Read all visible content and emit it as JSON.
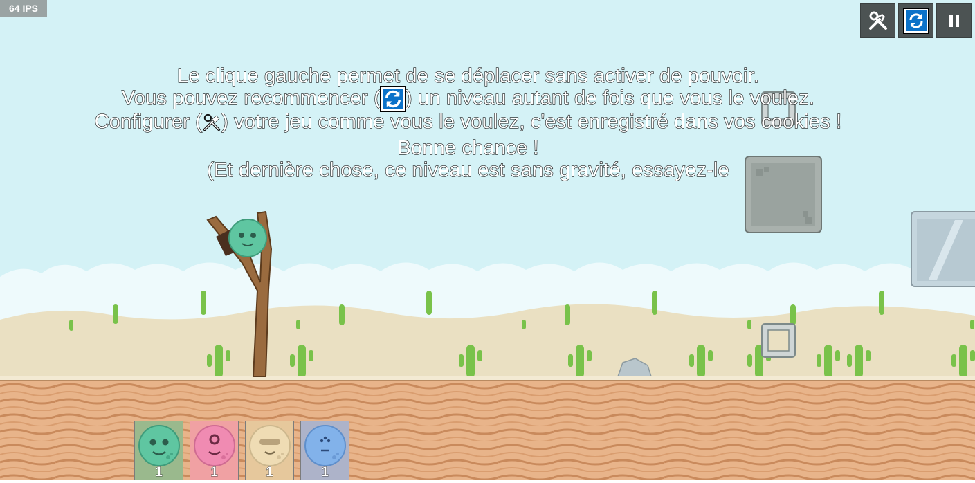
{
  "hud": {
    "fps_label": "64 IPS",
    "buttons": [
      {
        "name": "settings",
        "icon": "tools-icon"
      },
      {
        "name": "restart",
        "icon": "refresh-icon"
      },
      {
        "name": "pause",
        "icon": "pause-icon"
      }
    ]
  },
  "instructions": {
    "line1": "Le clique gauche permet de se déplacer sans activer de pouvoir.",
    "line2_before": "Vous pouvez recommencer (",
    "line2_after": ") un niveau autant de fois que vous le voulez.",
    "line3_before": "Configurer (",
    "line3_after": ") votre jeu comme vous le voulez, c'est enregistré dans vos cookies !",
    "line4": "Bonne chance !",
    "line5": "(Et dernière chose, ce niveau est sans gravité, essayez-le"
  },
  "birds": [
    {
      "kind": "green",
      "count": "1",
      "color": "#5fc6a1",
      "slot_bg": "#9ab98d"
    },
    {
      "kind": "pink",
      "count": "1",
      "color": "#f08bb2",
      "slot_bg": "#f0a1a3"
    },
    {
      "kind": "beige",
      "count": "1",
      "color": "#efdcb4",
      "slot_bg": "#e6c89c"
    },
    {
      "kind": "blue",
      "count": "1",
      "color": "#82b2ea",
      "slot_bg": "#adb3c9"
    }
  ],
  "colors": {
    "sky": "#d4f2f6",
    "sand": "#eae0c2",
    "ground": "#e8b48a",
    "cactus": "#79c24a",
    "slingshot": "#9a6b3f",
    "accent_blue": "#0b72c9"
  }
}
